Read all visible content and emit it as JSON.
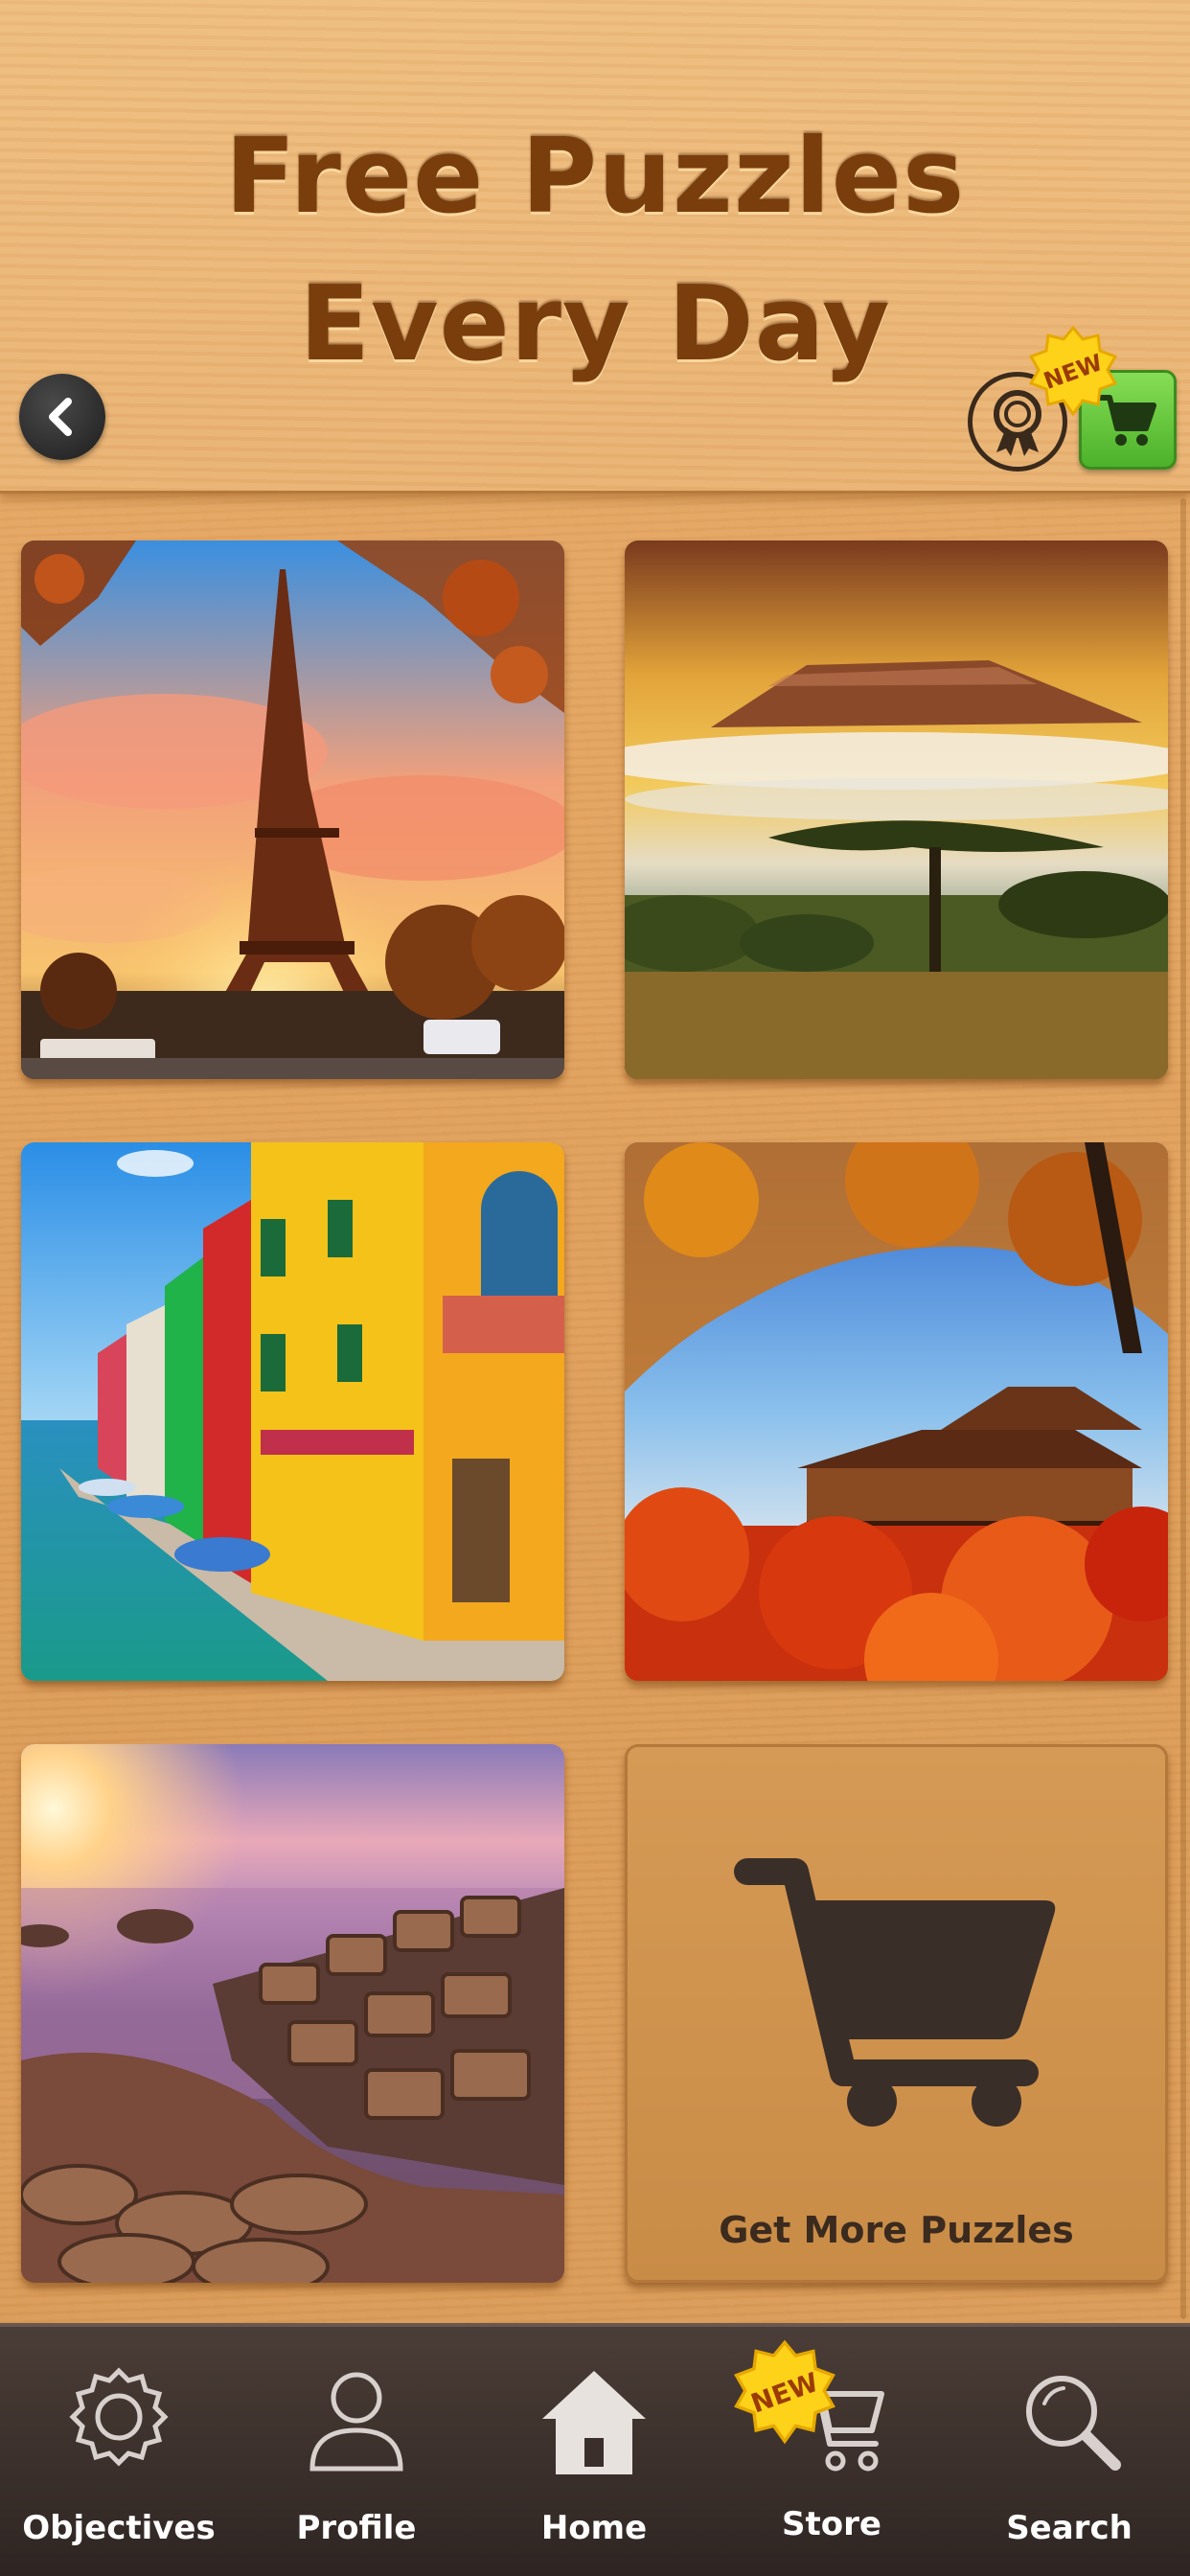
{
  "header": {
    "title_line1": "Free Puzzles",
    "title_line2": "Every Day",
    "new_badge": "NEW"
  },
  "icons": {
    "back": "chevron-left-icon",
    "award": "award-ribbon-icon",
    "cart": "shopping-cart-icon"
  },
  "puzzles": [
    {
      "name": "eiffel-tower"
    },
    {
      "name": "kilimanjaro-savanna"
    },
    {
      "name": "burano-colorful-houses"
    },
    {
      "name": "kyoto-temple-autumn"
    },
    {
      "name": "giants-causeway-sunset"
    }
  ],
  "more_tile": {
    "label": "Get More Puzzles"
  },
  "nav": {
    "objectives": "Objectives",
    "profile": "Profile",
    "home": "Home",
    "store": "Store",
    "search": "Search",
    "store_badge": "NEW",
    "active": "Home"
  },
  "colors": {
    "title_brown": "#7a3d0c",
    "nav_bg": "#3a2f2b",
    "cart_green": "#5fc436",
    "badge_yellow": "#ffd21a"
  }
}
